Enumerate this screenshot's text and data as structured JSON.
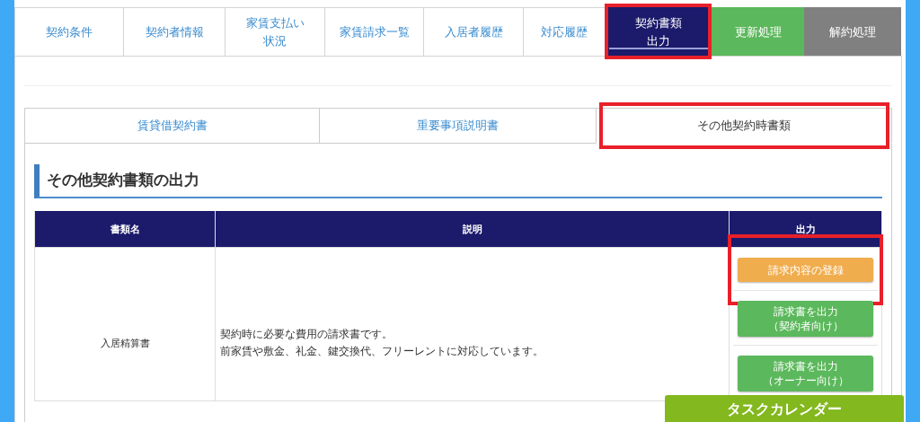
{
  "tabs": [
    {
      "lines": [
        "契約条件"
      ],
      "kind": "normal",
      "selected": false,
      "highlighted": false
    },
    {
      "lines": [
        "契約者情報"
      ],
      "kind": "normal",
      "selected": false,
      "highlighted": false
    },
    {
      "lines": [
        "家賃支払い",
        "状況"
      ],
      "kind": "normal",
      "selected": false,
      "highlighted": false
    },
    {
      "lines": [
        "家賃請求一覧"
      ],
      "kind": "normal",
      "selected": false,
      "highlighted": false
    },
    {
      "lines": [
        "入居者履歴"
      ],
      "kind": "normal",
      "selected": false,
      "highlighted": false
    },
    {
      "lines": [
        "対応履歴"
      ],
      "kind": "normal",
      "selected": false,
      "highlighted": false
    },
    {
      "lines": [
        "契約書類",
        "出力"
      ],
      "kind": "normal",
      "selected": true,
      "highlighted": true
    },
    {
      "lines": [
        "更新処理"
      ],
      "kind": "renew",
      "selected": false,
      "highlighted": false
    },
    {
      "lines": [
        "解約処理"
      ],
      "kind": "terminate",
      "selected": false,
      "highlighted": false
    }
  ],
  "subtabs": [
    {
      "label": "賃貸借契約書",
      "selected": false,
      "highlighted": false
    },
    {
      "label": "重要事項説明書",
      "selected": false,
      "highlighted": false
    },
    {
      "label": "その他契約時書類",
      "selected": true,
      "highlighted": true
    }
  ],
  "section_title": "その他契約書類の出力",
  "table": {
    "columns": [
      "書類名",
      "説明",
      "出力"
    ],
    "rows": [
      {
        "name": "入居精算書",
        "description_lines": [
          "契約時に必要な費用の請求書です。",
          "前家賃や敷金、礼金、鍵交換代、フリーレントに対応しています。"
        ],
        "buttons": [
          {
            "lines": [
              "請求内容の登録"
            ],
            "kind": "register",
            "highlighted": true
          },
          {
            "lines": [
              "請求書を出力",
              "（契約者向け）"
            ],
            "kind": "output",
            "highlighted": false
          },
          {
            "lines": [
              "請求書を出力",
              "（オーナー向け）"
            ],
            "kind": "output",
            "highlighted": false
          }
        ]
      }
    ]
  },
  "floating_button": "タスクカレンダー"
}
